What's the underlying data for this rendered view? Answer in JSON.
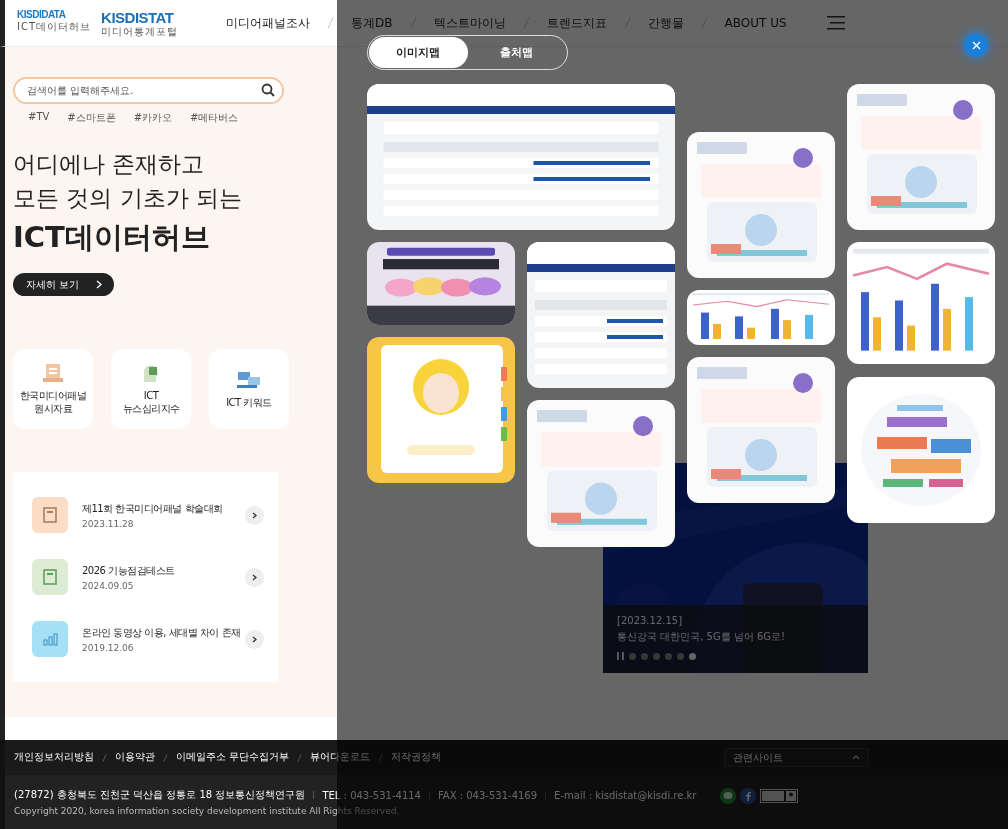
{
  "header": {
    "logos": [
      {
        "mark": "KISDIDATA",
        "caption": "ICT데이터허브"
      },
      {
        "mark": "KISDISTAT",
        "caption": "미디어통계포털"
      }
    ],
    "nav": [
      "미디어패널조사",
      "통계DB",
      "텍스트마이닝",
      "트렌드지표",
      "간행물",
      "ABOUT US"
    ]
  },
  "search": {
    "placeholder": "검색어를 입력해주세요."
  },
  "hashtags": [
    "#TV",
    "#스마트폰",
    "#카카오",
    "#메타버스"
  ],
  "hero": {
    "lines": [
      "어디에나 존재하고",
      "모든 것의 기초가 되는"
    ],
    "title": "ICT데이터허브",
    "button": "자세히 보기"
  },
  "categories": [
    {
      "label": "한국미디어패널\n원시자료"
    },
    {
      "label": "ICT\n뉴스심리지수"
    },
    {
      "label": "ICT 키워드"
    }
  ],
  "news": [
    {
      "title": "제11회 한국미디어패널 학술대회",
      "date": "2023.11.28",
      "color": "#fbdcc4"
    },
    {
      "title": "2026 기능점검테스트",
      "date": "2024.09.05",
      "color": "#dcebd3"
    },
    {
      "title": "온라인 동영상 이용, 세대별 차이 존재",
      "date": "2019.12.06",
      "color": "#a5e1f6"
    }
  ],
  "banner": {
    "kind": "picture",
    "date": "[2023.12.15]",
    "caption": "통신강국 대한민국, 5G를 넘어 6G로!",
    "dots": [
      {
        "selected": false
      },
      {
        "selected": false
      },
      {
        "selected": false
      },
      {
        "selected": false
      },
      {
        "selected": false
      },
      {
        "selected": true
      }
    ]
  },
  "image_map": {
    "tabs": [
      {
        "label": "이미지맵",
        "selected": true
      },
      {
        "label": "출처맵",
        "selected": false
      }
    ]
  },
  "footer": {
    "links": [
      "개인정보처리방침",
      "이용약관",
      "이메일주소 무단수집거부",
      "뷰어다운로드",
      "저작권정책"
    ],
    "related": "관련사이트",
    "address": [
      "(27872) 충청북도 진천군 덕산읍 정통로 18 정보통신정책연구원",
      "TEL : 043-531-4114",
      "FAX : 043-531-4169",
      "E-mail : kisdistat@kisdi.re.kr"
    ],
    "copyright": "Copyright 2020, korea information society development institute All Rights Reserved."
  }
}
